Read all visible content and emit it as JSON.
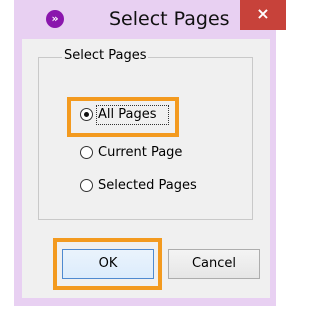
{
  "window": {
    "title": "Select Pages",
    "app_icon": "chevron-right-icon",
    "close_label": "×"
  },
  "group": {
    "label": "Select Pages",
    "options": [
      {
        "label": "All Pages",
        "selected": true
      },
      {
        "label": "Current Page",
        "selected": false
      },
      {
        "label": "Selected Pages",
        "selected": false
      }
    ]
  },
  "buttons": {
    "ok_label": "OK",
    "cancel_label": "Cancel"
  },
  "colors": {
    "titlebar": "#e8d0f2",
    "app_icon": "#8a16ad",
    "close_button": "#c7423a",
    "highlight": "#f39a1f",
    "default_button_border": "#4f8ad0"
  }
}
